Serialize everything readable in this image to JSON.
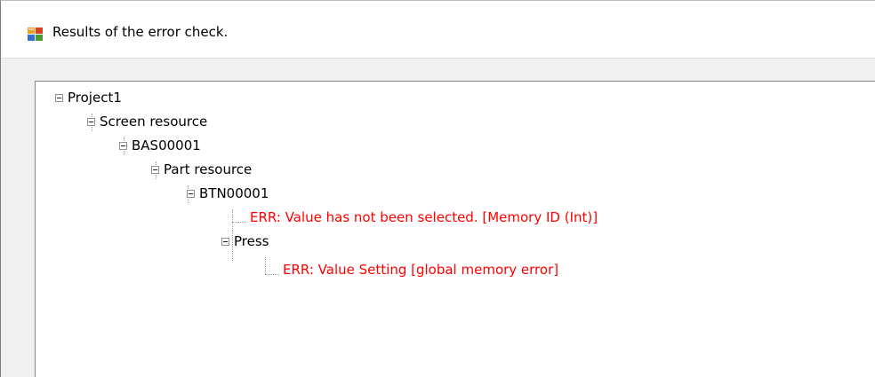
{
  "window": {
    "title": "Results of the error check.",
    "title_icon": "app-window-icon"
  },
  "tree": {
    "nodes": [
      {
        "label": "Project1",
        "level": 0,
        "type": "folder",
        "expanded": true
      },
      {
        "label": "Screen resource",
        "level": 1,
        "type": "folder",
        "expanded": true
      },
      {
        "label": "BAS00001",
        "level": 2,
        "type": "folder",
        "expanded": true
      },
      {
        "label": "Part resource",
        "level": 3,
        "type": "folder",
        "expanded": true
      },
      {
        "label": "BTN00001",
        "level": 4,
        "type": "folder",
        "expanded": true
      },
      {
        "label": "ERR: Value has not been selected. [Memory ID (Int)]",
        "level": 5,
        "type": "error"
      },
      {
        "label": "Press",
        "level": 5,
        "type": "folder",
        "expanded": true
      },
      {
        "label": "ERR: Value Setting [global memory error]",
        "level": 6,
        "type": "error"
      }
    ]
  },
  "colors": {
    "error_text": "#ff0000",
    "normal_text": "#000000",
    "window_bg": "#f0f0f0",
    "panel_bg": "#ffffff"
  }
}
